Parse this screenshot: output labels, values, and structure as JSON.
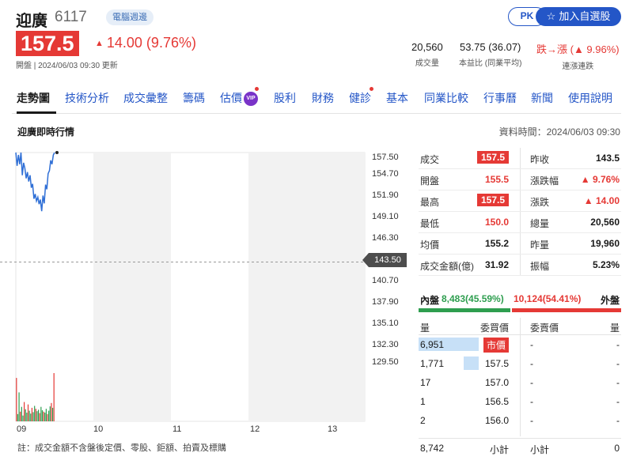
{
  "stock": {
    "name": "迎廣",
    "code": "6117",
    "tag": "電腦週邊"
  },
  "actions": {
    "pk": "PK",
    "watchlist": "加入自選股"
  },
  "price": {
    "current": "157.5",
    "change": "14.00 (9.76%)",
    "open_info": "開盤 | 2024/06/03 09:30 更新"
  },
  "stats": {
    "volume": {
      "value": "20,560",
      "label": "成交量"
    },
    "pe": {
      "value": "53.75 (36.07)",
      "label": "本益比 (同業平均)"
    },
    "streak": {
      "value": "跌→漲 (▲ 9.96%)",
      "label": "連漲連跌"
    }
  },
  "tabs": [
    "走勢圖",
    "技術分析",
    "成交彙整",
    "籌碼",
    "估價",
    "股利",
    "財務",
    "健診",
    "基本",
    "同業比較",
    "行事曆",
    "新聞",
    "使用說明"
  ],
  "vip_label": "VIP",
  "section": {
    "title": "迎廣即時行情",
    "data_time": "資料時間：2024/06/03 09:30"
  },
  "chart": {
    "y_ticks": [
      "157.50",
      "154.70",
      "151.90",
      "149.10",
      "146.30",
      "140.70",
      "137.90",
      "135.10",
      "132.30",
      "129.50"
    ],
    "prev_close": "143.50",
    "x_ticks": [
      "09",
      "10",
      "11",
      "12",
      "13"
    ],
    "footnote": "註：成交金額不含盤後定價、零股、鉅額、拍賣及標購"
  },
  "chart_data": {
    "type": "line",
    "title": "迎廣即時行情",
    "x_label": "",
    "y_label": "",
    "ylim": [
      129.5,
      157.5
    ],
    "reference_line": 143.5,
    "x_range": [
      "09:00",
      "13:30"
    ],
    "price_series": {
      "time_min": [
        0,
        1,
        2,
        3,
        4,
        5,
        6,
        7,
        8,
        9,
        10,
        11,
        12,
        13,
        14,
        15,
        16,
        17,
        18,
        19,
        20,
        21,
        22,
        23,
        24,
        25,
        26,
        27,
        28,
        29,
        30
      ],
      "values": [
        157.5,
        155.8,
        157.2,
        156.0,
        157.5,
        154.6,
        156.2,
        155.5,
        154.2,
        155.0,
        153.8,
        154.6,
        153.0,
        153.5,
        151.6,
        152.2,
        151.3,
        151.8,
        150.9,
        151.5,
        150.0,
        152.0,
        151.0,
        153.4,
        152.8,
        154.8,
        155.2,
        156.5,
        156.0,
        157.2,
        157.5
      ]
    },
    "volume_series": {
      "values": [
        900,
        150,
        600,
        200,
        300,
        120,
        400,
        250,
        180,
        350,
        220,
        160,
        280,
        190,
        320,
        260,
        210,
        240,
        170,
        300,
        230,
        200,
        180,
        260,
        150,
        220,
        310,
        380,
        280,
        1000
      ]
    },
    "colors": {
      "line": "#2f6fd6",
      "volume_up": "#e53935",
      "volume_down": "#2e9e4f",
      "shade": "#f2f2f2"
    }
  },
  "quote": {
    "rows": [
      {
        "l_label": "成交",
        "l_val": "157.5",
        "l_style": "boxed",
        "r_label": "昨收",
        "r_val": "143.5",
        "r_style": ""
      },
      {
        "l_label": "開盤",
        "l_val": "155.5",
        "l_style": "red",
        "r_label": "漲跌幅",
        "r_val": "▲ 9.76%",
        "r_style": "red"
      },
      {
        "l_label": "最高",
        "l_val": "157.5",
        "l_style": "boxed",
        "r_label": "漲跌",
        "r_val": "▲ 14.00",
        "r_style": "red"
      },
      {
        "l_label": "最低",
        "l_val": "150.0",
        "l_style": "red",
        "r_label": "總量",
        "r_val": "20,560",
        "r_style": ""
      },
      {
        "l_label": "均價",
        "l_val": "155.2",
        "l_style": "",
        "r_label": "昨量",
        "r_val": "19,960",
        "r_style": ""
      },
      {
        "l_label": "成交金額(億)",
        "l_val": "31.92",
        "l_style": "",
        "r_label": "振幅",
        "r_val": "5.23%",
        "r_style": ""
      }
    ]
  },
  "bid_ask": {
    "inner_label": "內盤",
    "inner_value": "8,483(45.59%)",
    "outer_value": "10,124(54.41%)",
    "outer_label": "外盤",
    "inner_pct": 45.59,
    "colors": {
      "inner": "#2e9e4f",
      "outer": "#e53935"
    }
  },
  "order_book": {
    "headers": {
      "bid_qty": "量",
      "bid_price": "委買價",
      "ask_price": "委賣價",
      "ask_qty": "量"
    },
    "rows": [
      {
        "bid_qty": "6,951",
        "bid_price": "市價",
        "bid_fill": 1.0,
        "ask_price": "-",
        "ask_qty": "-"
      },
      {
        "bid_qty": "1,771",
        "bid_price": "157.5",
        "bid_fill": 0.255,
        "ask_price": "-",
        "ask_qty": "-"
      },
      {
        "bid_qty": "17",
        "bid_price": "157.0",
        "bid_fill": 0,
        "ask_price": "-",
        "ask_qty": "-"
      },
      {
        "bid_qty": "1",
        "bid_price": "156.5",
        "bid_fill": 0,
        "ask_price": "-",
        "ask_qty": "-"
      },
      {
        "bid_qty": "2",
        "bid_price": "156.0",
        "bid_fill": 0,
        "ask_price": "-",
        "ask_qty": "-"
      }
    ],
    "total": {
      "bid_qty": "8,742",
      "bid_label": "小計",
      "ask_label": "小計",
      "ask_qty": "0"
    }
  }
}
